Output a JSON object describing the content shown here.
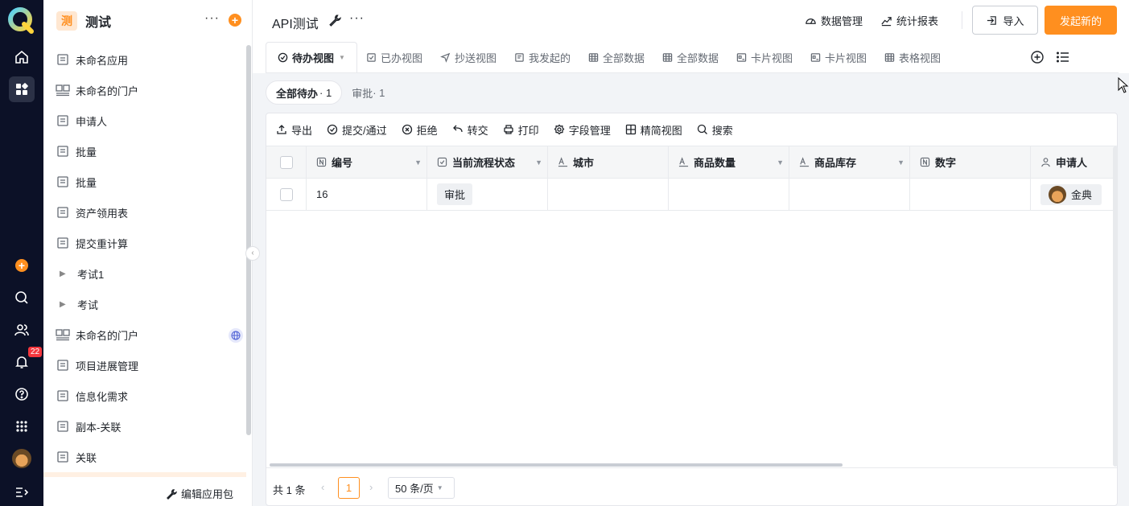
{
  "rail": {
    "notification_count": "22",
    "items": [
      "home-icon",
      "apps-icon",
      "add-icon",
      "search-icon",
      "contacts-icon",
      "bell-icon",
      "help-icon",
      "grid-icon",
      "avatar",
      "expand-icon"
    ]
  },
  "sidebar": {
    "app_badge": "测",
    "app_name": "测试",
    "items": [
      {
        "label": "未命名应用",
        "icon": "form-icon"
      },
      {
        "label": "未命名的门户",
        "icon": "portal-icon"
      },
      {
        "label": "申请人",
        "icon": "form-icon"
      },
      {
        "label": "批量",
        "icon": "form-icon"
      },
      {
        "label": "批量",
        "icon": "form-icon"
      },
      {
        "label": "资产领用表",
        "icon": "form-icon"
      },
      {
        "label": "提交重计算",
        "icon": "form-icon"
      },
      {
        "label": "考试1",
        "icon": "caret-right-icon"
      },
      {
        "label": "考试",
        "icon": "caret-right-icon"
      },
      {
        "label": "未命名的门户",
        "icon": "portal-icon"
      },
      {
        "label": "项目进展管理",
        "icon": "form-icon"
      },
      {
        "label": "信息化需求",
        "icon": "form-icon"
      },
      {
        "label": "副本-关联",
        "icon": "form-icon"
      },
      {
        "label": "关联",
        "icon": "form-icon"
      }
    ],
    "edit_package": "编辑应用包"
  },
  "header": {
    "title": "API测试",
    "data_manage": "数据管理",
    "stats_report": "统计报表",
    "import": "导入",
    "new": "发起新的"
  },
  "tabs": [
    {
      "label": "待办视图",
      "icon": "check-circle-icon"
    },
    {
      "label": "已办视图",
      "icon": "check-square-icon"
    },
    {
      "label": "抄送视图",
      "icon": "send-icon"
    },
    {
      "label": "我发起的",
      "icon": "doc-icon"
    },
    {
      "label": "全部数据",
      "icon": "table-icon"
    },
    {
      "label": "全部数据",
      "icon": "table-icon"
    },
    {
      "label": "卡片视图",
      "icon": "card-icon"
    },
    {
      "label": "卡片视图",
      "icon": "card-icon"
    },
    {
      "label": "表格视图",
      "icon": "table-icon"
    }
  ],
  "subtabs": [
    {
      "label": "全部待办",
      "count": "· 1"
    },
    {
      "label": "审批",
      "count": "· 1"
    }
  ],
  "toolbar": [
    "导出",
    "提交/通过",
    "拒绝",
    "转交",
    "打印",
    "字段管理",
    "精简视图",
    "搜索"
  ],
  "table": {
    "columns": [
      {
        "label": "编号",
        "icon": "number-icon"
      },
      {
        "label": "当前流程状态",
        "icon": "check-square-icon"
      },
      {
        "label": "城市",
        "icon": "text-icon"
      },
      {
        "label": "商品数量",
        "icon": "text-icon"
      },
      {
        "label": "商品库存",
        "icon": "text-icon"
      },
      {
        "label": "数字",
        "icon": "number-icon"
      },
      {
        "label": "申请人",
        "icon": "user-icon"
      }
    ],
    "rows": [
      {
        "id": "16",
        "status": "审批",
        "city": "",
        "qty": "",
        "stock": "",
        "num": "",
        "applicant": "金典"
      }
    ]
  },
  "pagination": {
    "total": "共 1 条",
    "page": "1",
    "page_size": "50 条/页"
  },
  "colors": {
    "accent": "#ff8f1f",
    "rail": "#0c1127"
  }
}
